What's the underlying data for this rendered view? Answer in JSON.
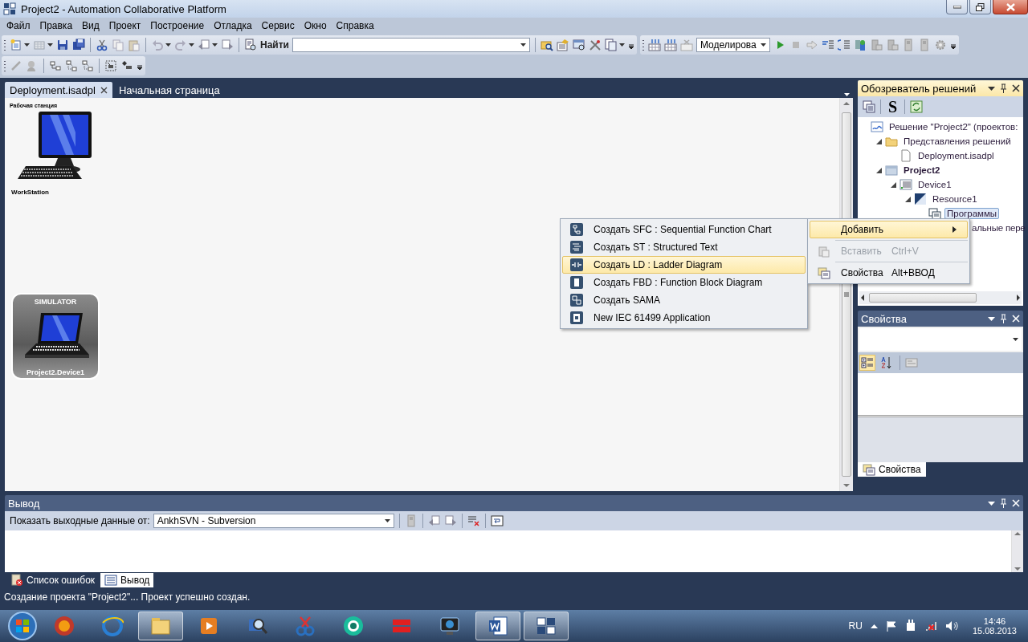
{
  "window": {
    "title": "Project2 - Automation Collaborative Platform"
  },
  "menu": [
    "Файл",
    "Правка",
    "Вид",
    "Проект",
    "Построение",
    "Отладка",
    "Сервис",
    "Окно",
    "Справка"
  ],
  "toolbar": {
    "find_label": "Найти",
    "mode": "Моделирова"
  },
  "document_tabs": [
    {
      "label": "Deployment.isadpl",
      "selected": true
    },
    {
      "label": "Начальная страница",
      "selected": false
    }
  ],
  "canvas": {
    "nodes": [
      {
        "kind": "workstation",
        "caption": "Рабочая станция",
        "name": "WorkStation"
      },
      {
        "kind": "simulator",
        "caption": "SIMULATOR",
        "name": "Project2.Device1"
      }
    ]
  },
  "solution_explorer": {
    "title": "Обозреватель решений",
    "toolbar_symbol": "S",
    "tree": [
      {
        "label": "Решение \"Project2\"  (проектов:",
        "kind": "solution",
        "selected": false,
        "children": [
          {
            "label": "Представления решений",
            "kind": "folder",
            "selected": false,
            "expanded": true,
            "children": [
              {
                "label": "Deployment.isadpl",
                "kind": "file",
                "selected": false
              }
            ]
          },
          {
            "label": "Project2",
            "kind": "project",
            "selected": false,
            "expanded": true,
            "children": [
              {
                "label": "Device1",
                "kind": "device",
                "selected": false,
                "expanded": true,
                "children": [
                  {
                    "label": "Resource1",
                    "kind": "resource",
                    "selected": false,
                    "expanded": true,
                    "children": [
                      {
                        "label": "Программы",
                        "kind": "programs",
                        "selected": true
                      },
                      {
                        "label": "альные пере",
                        "kind": "cut",
                        "selected": false
                      }
                    ]
                  }
                ]
              }
            ]
          }
        ]
      }
    ]
  },
  "context_menu": [
    {
      "label": "Добавить",
      "kind": "submenu",
      "selected": true,
      "disabled": false
    },
    {
      "label": "Вставить",
      "shortcut": "Ctrl+V",
      "kind": "command",
      "selected": false,
      "disabled": true
    },
    {
      "label": "Свойства",
      "shortcut": "Alt+ВВОД",
      "kind": "command",
      "selected": false,
      "disabled": false
    }
  ],
  "submenu": [
    {
      "label": "Создать SFC : Sequential Function Chart",
      "selected": false
    },
    {
      "label": "Создать ST : Structured Text",
      "selected": false
    },
    {
      "label": "Создать LD : Ladder Diagram",
      "selected": true
    },
    {
      "label": "Создать FBD : Function Block Diagram",
      "selected": false
    },
    {
      "label": "Создать SAMA",
      "selected": false
    },
    {
      "label": "New IEC 61499 Application",
      "selected": false
    }
  ],
  "properties": {
    "title": "Свойства",
    "tab": "Свойства",
    "sort_buttons": [
      {
        "kind": "categorized",
        "selected": true
      },
      {
        "kind": "alphabetical",
        "selected": false
      }
    ]
  },
  "output": {
    "title": "Вывод",
    "source_label": "Показать выходные данные от:",
    "source": "AnkhSVN - Subversion"
  },
  "bottom_tabs": [
    {
      "label": "Список ошибок",
      "kind": "errors",
      "selected": false
    },
    {
      "label": "Вывод",
      "kind": "output",
      "selected": true
    }
  ],
  "status_bar": "Создание проекта \"Project2\"... Проект успешно создан.",
  "taskbar": {
    "apps": [
      {
        "running": false
      },
      {
        "running": false
      },
      {
        "running": true
      },
      {
        "running": false
      },
      {
        "running": false
      },
      {
        "running": false
      },
      {
        "running": false
      },
      {
        "running": false
      },
      {
        "running": false
      },
      {
        "running": true
      },
      {
        "running": true
      }
    ],
    "language": "RU",
    "time": "14:46",
    "date": "15.08.2013"
  }
}
